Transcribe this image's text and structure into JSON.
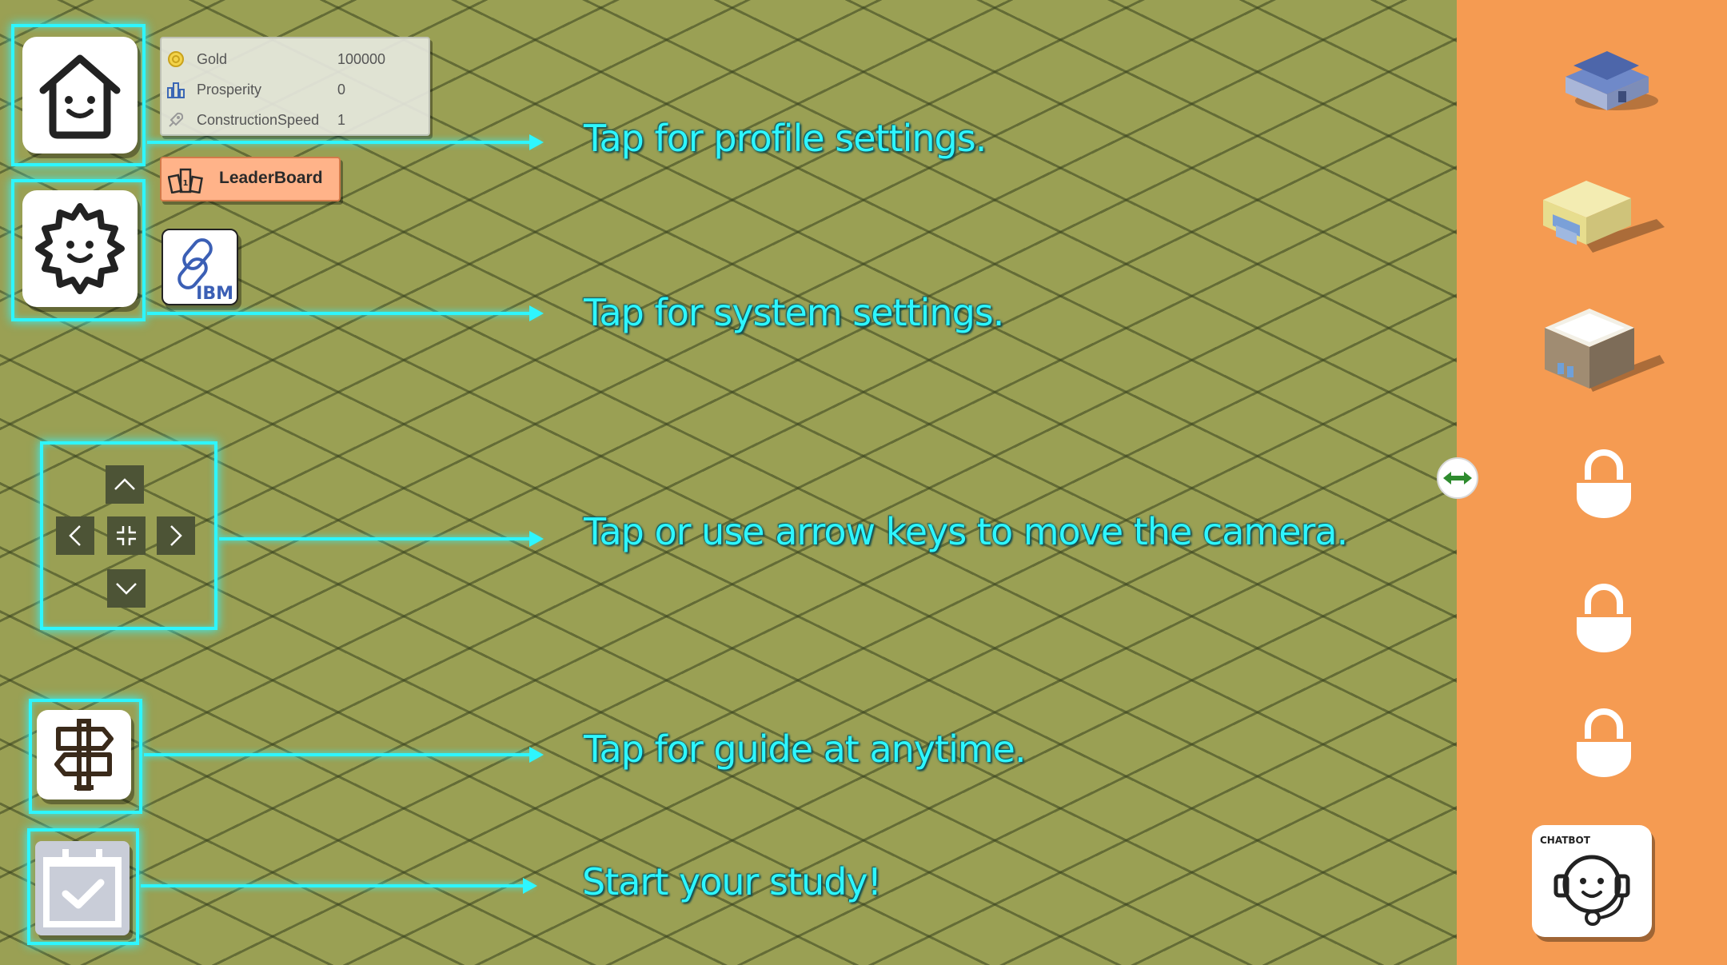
{
  "stats": {
    "gold_label": "Gold",
    "gold_value": "100000",
    "prosperity_label": "Prosperity",
    "prosperity_value": "0",
    "speed_label": "ConstructionSpeed",
    "speed_value": "1"
  },
  "leaderboard": {
    "label": "LeaderBoard"
  },
  "ibm": {
    "label": "IBM"
  },
  "captions": {
    "profile": "Tap for profile settings.",
    "system": "Tap for system settings.",
    "camera": "Tap or use arrow keys to move the camera.",
    "guide": "Tap for guide  at  anytime.",
    "study": "Start your study!"
  },
  "chatbot": {
    "label": "CHATBOT"
  },
  "sidebar": {
    "buildings": [
      "house-building",
      "shop-building",
      "office-building"
    ],
    "locked_slots": 3
  },
  "colors": {
    "highlight": "#2ef6ff",
    "sidebar": "#f59b52",
    "ground": "#9aa054",
    "leaderboard": "#ffb389"
  }
}
